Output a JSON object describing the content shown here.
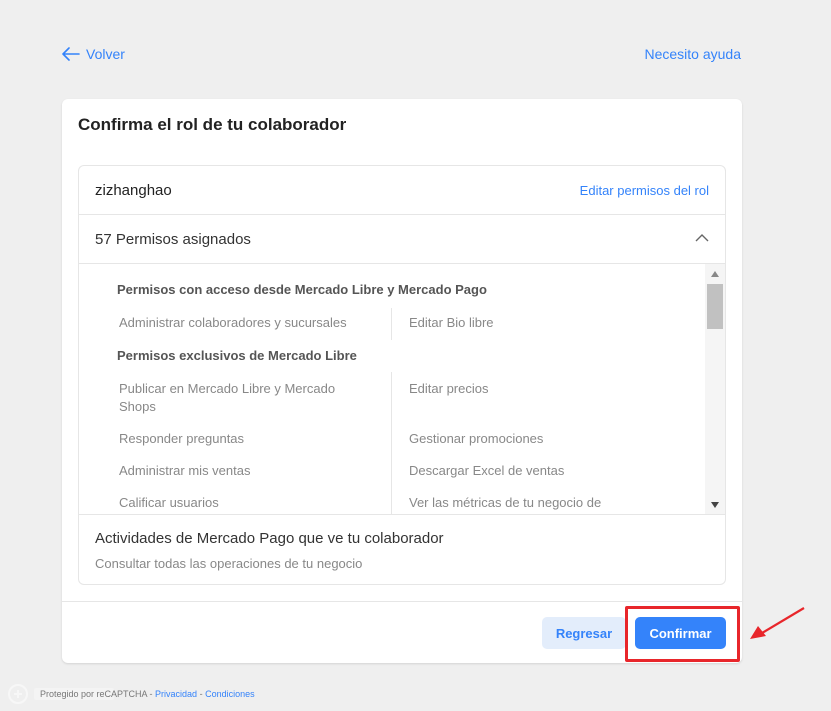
{
  "nav": {
    "back_label": "Volver",
    "help_label": "Necesito ayuda"
  },
  "card": {
    "title": "Confirma el rol de tu colaborador",
    "role": {
      "name": "zizhanghao",
      "edit_label": "Editar permisos del rol"
    },
    "permissions": {
      "count_label": "57 Permisos asignados",
      "groups": [
        {
          "title": "Permisos con acceso desde Mercado Libre y Mercado Pago",
          "left": [
            "Administrar colaboradores y sucursales"
          ],
          "right": [
            "Editar Bio libre"
          ]
        },
        {
          "title": "Permisos exclusivos de Mercado Libre",
          "left": [
            "Publicar en Mercado Libre y Mercado Shops",
            "Responder preguntas",
            "Administrar mis ventas",
            "Calificar usuarios"
          ],
          "right": [
            "Editar precios",
            "Gestionar promociones",
            "Descargar Excel de ventas",
            "Ver las métricas de tu negocio de"
          ]
        }
      ]
    },
    "mercadopago": {
      "title": "Actividades de Mercado Pago que ve tu colaborador",
      "desc": "Consultar todas las operaciones de tu negocio"
    },
    "buttons": {
      "back": "Regresar",
      "confirm": "Confirmar"
    }
  },
  "footer": {
    "recaptcha_text": "Protegido por reCAPTCHA - ",
    "privacy": "Privacidad",
    "sep": " - ",
    "terms": "Condiciones"
  },
  "colors": {
    "accent": "#3483fa",
    "highlight": "#e8262b"
  }
}
